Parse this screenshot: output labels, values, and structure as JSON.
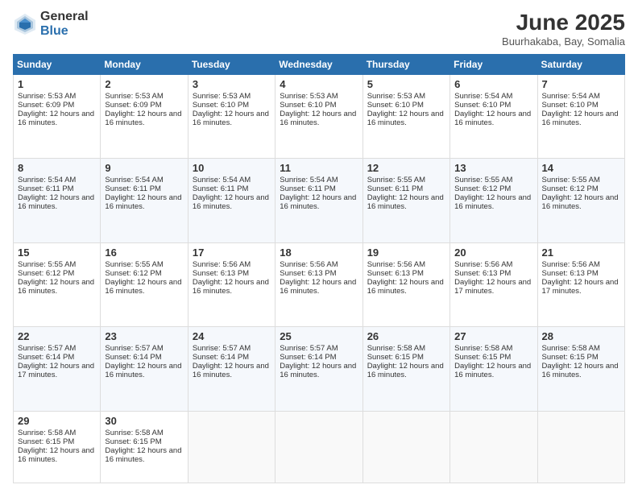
{
  "logo": {
    "general": "General",
    "blue": "Blue"
  },
  "title": {
    "month_year": "June 2025",
    "location": "Buurhakaba, Bay, Somalia"
  },
  "days_of_week": [
    "Sunday",
    "Monday",
    "Tuesday",
    "Wednesday",
    "Thursday",
    "Friday",
    "Saturday"
  ],
  "weeks": [
    [
      {
        "day": "1",
        "sunrise": "Sunrise: 5:53 AM",
        "sunset": "Sunset: 6:09 PM",
        "daylight": "Daylight: 12 hours and 16 minutes."
      },
      {
        "day": "2",
        "sunrise": "Sunrise: 5:53 AM",
        "sunset": "Sunset: 6:09 PM",
        "daylight": "Daylight: 12 hours and 16 minutes."
      },
      {
        "day": "3",
        "sunrise": "Sunrise: 5:53 AM",
        "sunset": "Sunset: 6:10 PM",
        "daylight": "Daylight: 12 hours and 16 minutes."
      },
      {
        "day": "4",
        "sunrise": "Sunrise: 5:53 AM",
        "sunset": "Sunset: 6:10 PM",
        "daylight": "Daylight: 12 hours and 16 minutes."
      },
      {
        "day": "5",
        "sunrise": "Sunrise: 5:53 AM",
        "sunset": "Sunset: 6:10 PM",
        "daylight": "Daylight: 12 hours and 16 minutes."
      },
      {
        "day": "6",
        "sunrise": "Sunrise: 5:54 AM",
        "sunset": "Sunset: 6:10 PM",
        "daylight": "Daylight: 12 hours and 16 minutes."
      },
      {
        "day": "7",
        "sunrise": "Sunrise: 5:54 AM",
        "sunset": "Sunset: 6:10 PM",
        "daylight": "Daylight: 12 hours and 16 minutes."
      }
    ],
    [
      {
        "day": "8",
        "sunrise": "Sunrise: 5:54 AM",
        "sunset": "Sunset: 6:11 PM",
        "daylight": "Daylight: 12 hours and 16 minutes."
      },
      {
        "day": "9",
        "sunrise": "Sunrise: 5:54 AM",
        "sunset": "Sunset: 6:11 PM",
        "daylight": "Daylight: 12 hours and 16 minutes."
      },
      {
        "day": "10",
        "sunrise": "Sunrise: 5:54 AM",
        "sunset": "Sunset: 6:11 PM",
        "daylight": "Daylight: 12 hours and 16 minutes."
      },
      {
        "day": "11",
        "sunrise": "Sunrise: 5:54 AM",
        "sunset": "Sunset: 6:11 PM",
        "daylight": "Daylight: 12 hours and 16 minutes."
      },
      {
        "day": "12",
        "sunrise": "Sunrise: 5:55 AM",
        "sunset": "Sunset: 6:11 PM",
        "daylight": "Daylight: 12 hours and 16 minutes."
      },
      {
        "day": "13",
        "sunrise": "Sunrise: 5:55 AM",
        "sunset": "Sunset: 6:12 PM",
        "daylight": "Daylight: 12 hours and 16 minutes."
      },
      {
        "day": "14",
        "sunrise": "Sunrise: 5:55 AM",
        "sunset": "Sunset: 6:12 PM",
        "daylight": "Daylight: 12 hours and 16 minutes."
      }
    ],
    [
      {
        "day": "15",
        "sunrise": "Sunrise: 5:55 AM",
        "sunset": "Sunset: 6:12 PM",
        "daylight": "Daylight: 12 hours and 16 minutes."
      },
      {
        "day": "16",
        "sunrise": "Sunrise: 5:55 AM",
        "sunset": "Sunset: 6:12 PM",
        "daylight": "Daylight: 12 hours and 16 minutes."
      },
      {
        "day": "17",
        "sunrise": "Sunrise: 5:56 AM",
        "sunset": "Sunset: 6:13 PM",
        "daylight": "Daylight: 12 hours and 16 minutes."
      },
      {
        "day": "18",
        "sunrise": "Sunrise: 5:56 AM",
        "sunset": "Sunset: 6:13 PM",
        "daylight": "Daylight: 12 hours and 16 minutes."
      },
      {
        "day": "19",
        "sunrise": "Sunrise: 5:56 AM",
        "sunset": "Sunset: 6:13 PM",
        "daylight": "Daylight: 12 hours and 16 minutes."
      },
      {
        "day": "20",
        "sunrise": "Sunrise: 5:56 AM",
        "sunset": "Sunset: 6:13 PM",
        "daylight": "Daylight: 12 hours and 17 minutes."
      },
      {
        "day": "21",
        "sunrise": "Sunrise: 5:56 AM",
        "sunset": "Sunset: 6:13 PM",
        "daylight": "Daylight: 12 hours and 17 minutes."
      }
    ],
    [
      {
        "day": "22",
        "sunrise": "Sunrise: 5:57 AM",
        "sunset": "Sunset: 6:14 PM",
        "daylight": "Daylight: 12 hours and 17 minutes."
      },
      {
        "day": "23",
        "sunrise": "Sunrise: 5:57 AM",
        "sunset": "Sunset: 6:14 PM",
        "daylight": "Daylight: 12 hours and 16 minutes."
      },
      {
        "day": "24",
        "sunrise": "Sunrise: 5:57 AM",
        "sunset": "Sunset: 6:14 PM",
        "daylight": "Daylight: 12 hours and 16 minutes."
      },
      {
        "day": "25",
        "sunrise": "Sunrise: 5:57 AM",
        "sunset": "Sunset: 6:14 PM",
        "daylight": "Daylight: 12 hours and 16 minutes."
      },
      {
        "day": "26",
        "sunrise": "Sunrise: 5:58 AM",
        "sunset": "Sunset: 6:15 PM",
        "daylight": "Daylight: 12 hours and 16 minutes."
      },
      {
        "day": "27",
        "sunrise": "Sunrise: 5:58 AM",
        "sunset": "Sunset: 6:15 PM",
        "daylight": "Daylight: 12 hours and 16 minutes."
      },
      {
        "day": "28",
        "sunrise": "Sunrise: 5:58 AM",
        "sunset": "Sunset: 6:15 PM",
        "daylight": "Daylight: 12 hours and 16 minutes."
      }
    ],
    [
      {
        "day": "29",
        "sunrise": "Sunrise: 5:58 AM",
        "sunset": "Sunset: 6:15 PM",
        "daylight": "Daylight: 12 hours and 16 minutes."
      },
      {
        "day": "30",
        "sunrise": "Sunrise: 5:58 AM",
        "sunset": "Sunset: 6:15 PM",
        "daylight": "Daylight: 12 hours and 16 minutes."
      },
      {
        "day": "",
        "sunrise": "",
        "sunset": "",
        "daylight": ""
      },
      {
        "day": "",
        "sunrise": "",
        "sunset": "",
        "daylight": ""
      },
      {
        "day": "",
        "sunrise": "",
        "sunset": "",
        "daylight": ""
      },
      {
        "day": "",
        "sunrise": "",
        "sunset": "",
        "daylight": ""
      },
      {
        "day": "",
        "sunrise": "",
        "sunset": "",
        "daylight": ""
      }
    ]
  ]
}
